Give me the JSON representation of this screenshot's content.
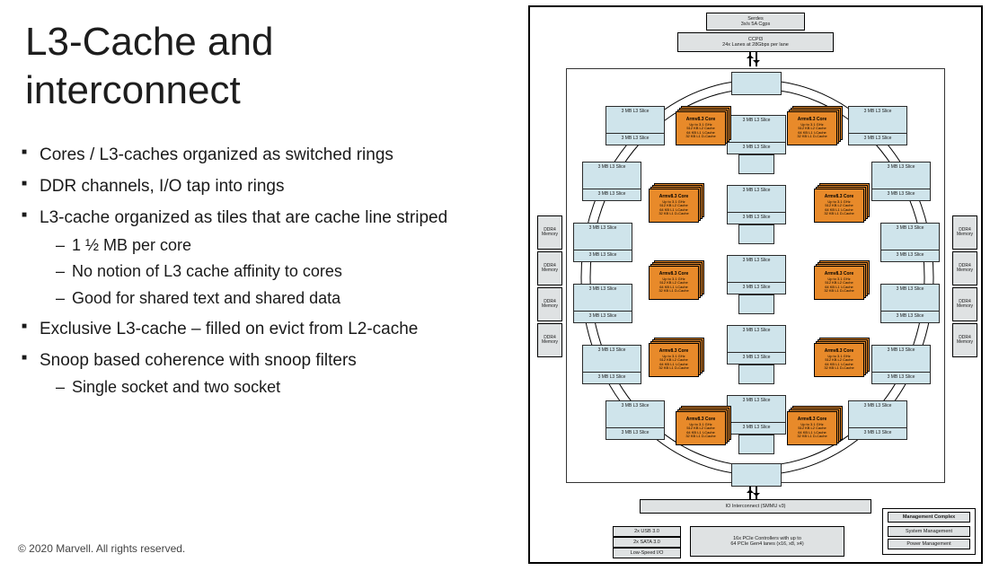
{
  "title_line1": "L3-Cache and",
  "title_line2": "interconnect",
  "bullets": {
    "b1": "Cores / L3-caches organized as switched rings",
    "b2": "DDR channels, I/O tap into rings",
    "b3": "L3-cache organized as tiles that are cache line striped",
    "b3s": [
      "1 ½ MB per core",
      "No notion of L3 cache affinity to cores",
      "Good for shared text and shared data"
    ],
    "b4": "Exclusive L3-cache – filled on evict from L2-cache",
    "b5": "Snoop based coherence with snoop filters",
    "b5s": [
      "Single socket and two socket"
    ]
  },
  "copyright": "© 2020 Marvell. All rights reserved.",
  "diagram": {
    "top_serdes": "Serdes\n3x/s 5A Cgps",
    "top_ccpi": "CCPI3\n24x Lanes at 28Gbps per lane",
    "slot_label": "3 MB L3 Slice",
    "core": {
      "title": "Armv8.3 Core",
      "l1": "Up to 3.1 GHz",
      "l2": "512 KB L2 Cache",
      "l3": "64 KB L1 I-Cache",
      "l4": "32 KB L1 D-Cache"
    },
    "mem_label": "DDR4 Memory",
    "io_interconnect": "IO Interconnect (SMMU v3)",
    "low_usb": "2x USB 3.0",
    "low_sata": "2x SATA 3.0",
    "low_ls": "Low-Speed I/O",
    "pcie": "16x PCIe Controllers with up to\n64 PCIe Gen4 lanes (x16, x8, x4)",
    "mc_title": "Management Complex",
    "mc_sys": "System Management",
    "mc_pwr": "Power Management"
  }
}
